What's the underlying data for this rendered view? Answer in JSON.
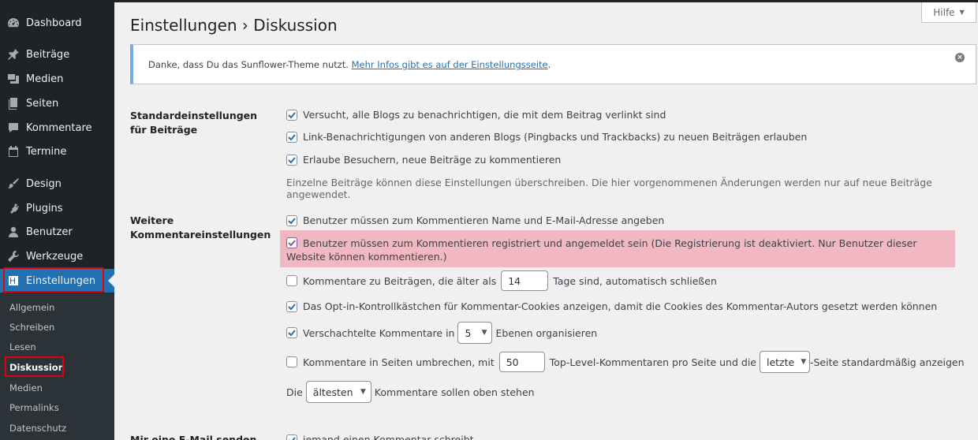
{
  "sidebar": {
    "menu": [
      {
        "label": "Dashboard",
        "icon": "dashboard-icon"
      },
      {
        "label": "Beiträge",
        "icon": "pin-icon"
      },
      {
        "label": "Medien",
        "icon": "media-icon"
      },
      {
        "label": "Seiten",
        "icon": "pages-icon"
      },
      {
        "label": "Kommentare",
        "icon": "comment-icon"
      },
      {
        "label": "Termine",
        "icon": "calendar-icon"
      },
      {
        "label": "Design",
        "icon": "brush-icon"
      },
      {
        "label": "Plugins",
        "icon": "plugin-icon"
      },
      {
        "label": "Benutzer",
        "icon": "user-icon"
      },
      {
        "label": "Werkzeuge",
        "icon": "wrench-icon"
      },
      {
        "label": "Einstellungen",
        "icon": "settings-icon"
      }
    ],
    "submenu": [
      "Allgemein",
      "Schreiben",
      "Lesen",
      "Diskussion",
      "Medien",
      "Permalinks",
      "Datenschutz"
    ]
  },
  "help": {
    "label": "Hilfe",
    "arrow": "▼"
  },
  "page": {
    "title": "Einstellungen › Diskussion"
  },
  "notice": {
    "text": "Danke, dass Du das Sunflower-Theme nutzt. ",
    "link": "Mehr Infos gibt es auf der Einstellungsseite",
    "after": "."
  },
  "section1": {
    "heading": "Standardeinstellungen für Beiträge",
    "opt1": "Versucht, alle Blogs zu benachrichtigen, die mit dem Beitrag verlinkt sind",
    "opt2": "Link-Benachrichtigungen von anderen Blogs (Pingbacks und Trackbacks) zu neuen Beiträgen erlauben",
    "opt3": "Erlaube Besuchern, neue Beiträge zu kommentieren",
    "desc": "Einzelne Beiträge können diese Einstellungen überschreiben. Die hier vorgenommenen Änderungen werden nur auf neue Beiträge angewendet."
  },
  "section2": {
    "heading": "Weitere Kommentareinstellungen",
    "opt1": "Benutzer müssen zum Kommentieren Name und E-Mail-Adresse angeben",
    "opt2": "Benutzer müssen zum Kommentieren registriert und angemeldet sein (Die Registrierung ist deaktiviert. Nur Benutzer dieser Website können kommentieren.)",
    "opt3_before": "Kommentare zu Beiträgen, die älter als",
    "opt3_value": "14",
    "opt3_after": "Tage sind, automatisch schließen",
    "opt4": "Das Opt-in-Kontrollkästchen für Kommentar-Cookies anzeigen, damit die Cookies des Kommentar-Autors gesetzt werden können",
    "opt5_before": "Verschachtelte Kommentare in",
    "opt5_value": "5",
    "opt5_after": "Ebenen organisieren",
    "opt6_before": "Kommentare in Seiten umbrechen, mit",
    "opt6_value": "50",
    "opt6_mid": "Top-Level-Kommentaren pro Seite und die",
    "opt6_select": "letzte",
    "opt6_after": "-Seite standardmäßig anzeigen",
    "opt7_before": "Die",
    "opt7_select": "ältesten",
    "opt7_after": "Kommentare sollen oben stehen"
  },
  "section3": {
    "heading": "Mir eine E-Mail senden, wenn",
    "opt1": "jemand einen Kommentar schreibt"
  },
  "colors": {
    "sidebar": "#1d2327",
    "active": "#2271b1",
    "highlight": "#f2b8c1",
    "annotation": "#e0000f"
  }
}
